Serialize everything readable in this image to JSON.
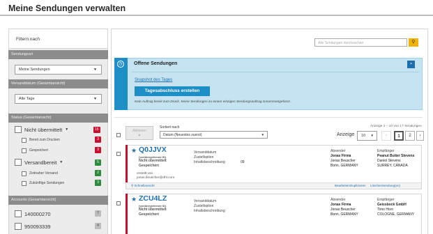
{
  "page": {
    "title": "Meine Sendungen verwalten"
  },
  "sidebar": {
    "filter_label": "Filtern nach",
    "sendungsart": {
      "header": "Sendungsart",
      "selected": "Meine Sendungen"
    },
    "versanddatum": {
      "header": "Versanddatum (Gesamtansicht)",
      "selected": "Alle Tage"
    },
    "status": {
      "header": "Status (Gesamtansicht)",
      "items": [
        {
          "label": "Nicht übermittelt",
          "count": "15"
        },
        {
          "label": "Bereit zum Drucken",
          "count": "3"
        },
        {
          "label": "Gespeichert",
          "count": "3"
        },
        {
          "label": "Versandbereit",
          "count": "5"
        },
        {
          "label": "Zeitnaher Versand",
          "count": "2"
        },
        {
          "label": "Zukünftige Sendungen",
          "count": "3"
        }
      ]
    },
    "accounts": {
      "header": "Accounts (Gesamtansicht)",
      "items": [
        {
          "label": "140000270",
          "count": "7"
        },
        {
          "label": "950093339",
          "count": "4"
        }
      ]
    }
  },
  "search": {
    "placeholder": "Alle Sendungen durchsuchen",
    "icon": "search-icon"
  },
  "offene": {
    "title": "Offene Sendungen",
    "snapshot_link": "Snapshot des Tages",
    "abschluss_button": "Tagesabschluss erstellen",
    "note": "Kein Auftrag bereit zum Druck. Keine Sendungen zu einem einzigen Sendungsauftrag zusammengefasst."
  },
  "toolbar": {
    "aktion_label": "Aktionen",
    "sort_label": "Sortiert nach",
    "sort_selected": "Datum (Neuestes zuerst)",
    "range_info": "Anzeige 1 – 10 von 17 Sendungen",
    "anzeige_label": "Anzeige",
    "anzeige_selected": "10",
    "pages": [
      "1",
      "2"
    ]
  },
  "shipments": [
    {
      "id": "Q0JJVX",
      "status_line1": "(vorübergehende ID)",
      "status_line2": "Nicht übermittelt",
      "status_line3": "Gespeichert",
      "field_labels": [
        "Versanddatum",
        "Zustelloption",
        "Inhaltsbeschreibung"
      ],
      "inhalt_value": "09",
      "absender_label": "Absender",
      "absender_lines": [
        "Jonas Firma",
        "Jonas Beuscher",
        "Bonn, GERMANY"
      ],
      "empfaenger_label": "Empfänger",
      "empfaenger_lines": [
        "Peanut Butter Stevens",
        "Daniel Stevens",
        "SURREY, CANADA"
      ],
      "created_label": "erstellt von",
      "created_by": "jonas.beuscher@dhl.com",
      "quick_view": "Schnellansicht",
      "actions": [
        "Bearbeiten",
        "Duplizieren",
        "Löschen",
        "Sendung(en)"
      ]
    },
    {
      "id": "ZCU4LZ",
      "status_line1": "(vorübergehende ID)",
      "status_line2": "Nicht übermittelt",
      "status_line3": "Gespeichert",
      "field_labels": [
        "Versanddatum",
        "Zustelloption",
        "Inhaltsbeschreibung"
      ],
      "absender_label": "Absender",
      "absender_lines": [
        "Jonas Firma",
        "Jonas Beuscher",
        "Bonn, GERMANY"
      ],
      "empfaenger_label": "Empfänger",
      "empfaenger_lines": [
        "Geissbock GmbH",
        "Timo Horn",
        "COLOGNE, GERMANY"
      ]
    }
  ],
  "colors": {
    "dhl_red": "#c8102e",
    "link_blue": "#1e6fb0",
    "info_blue": "#1e8ec6",
    "search_yellow": "#f0b400"
  }
}
